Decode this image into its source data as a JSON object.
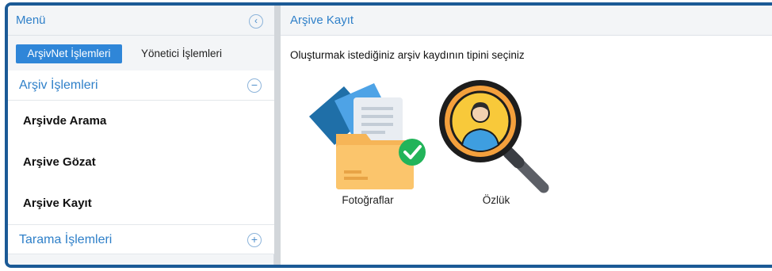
{
  "sidebar": {
    "menu_title": "Menü",
    "tabs": [
      {
        "label": "ArşivNet İşlemleri",
        "active": true
      },
      {
        "label": "Yönetici İşlemleri",
        "active": false
      }
    ],
    "sections": [
      {
        "title": "Arşiv İşlemleri",
        "expanded": true,
        "items": [
          {
            "label": "Arşivde Arama"
          },
          {
            "label": "Arşive Gözat"
          },
          {
            "label": "Arşive Kayıt"
          }
        ]
      },
      {
        "title": "Tarama İşlemleri",
        "expanded": false
      }
    ]
  },
  "main": {
    "title": "Arşive Kayıt",
    "instruction": "Oluşturmak istediğiniz arşiv kaydının tipini seçiniz",
    "options": [
      {
        "label": "Fotoğraflar",
        "icon": "folder-documents-check-icon"
      },
      {
        "label": "Özlük",
        "icon": "magnifier-person-icon"
      }
    ]
  },
  "colors": {
    "frame": "#1b5a96",
    "accent": "#2f80c9",
    "tab_active": "#2f86d8"
  }
}
